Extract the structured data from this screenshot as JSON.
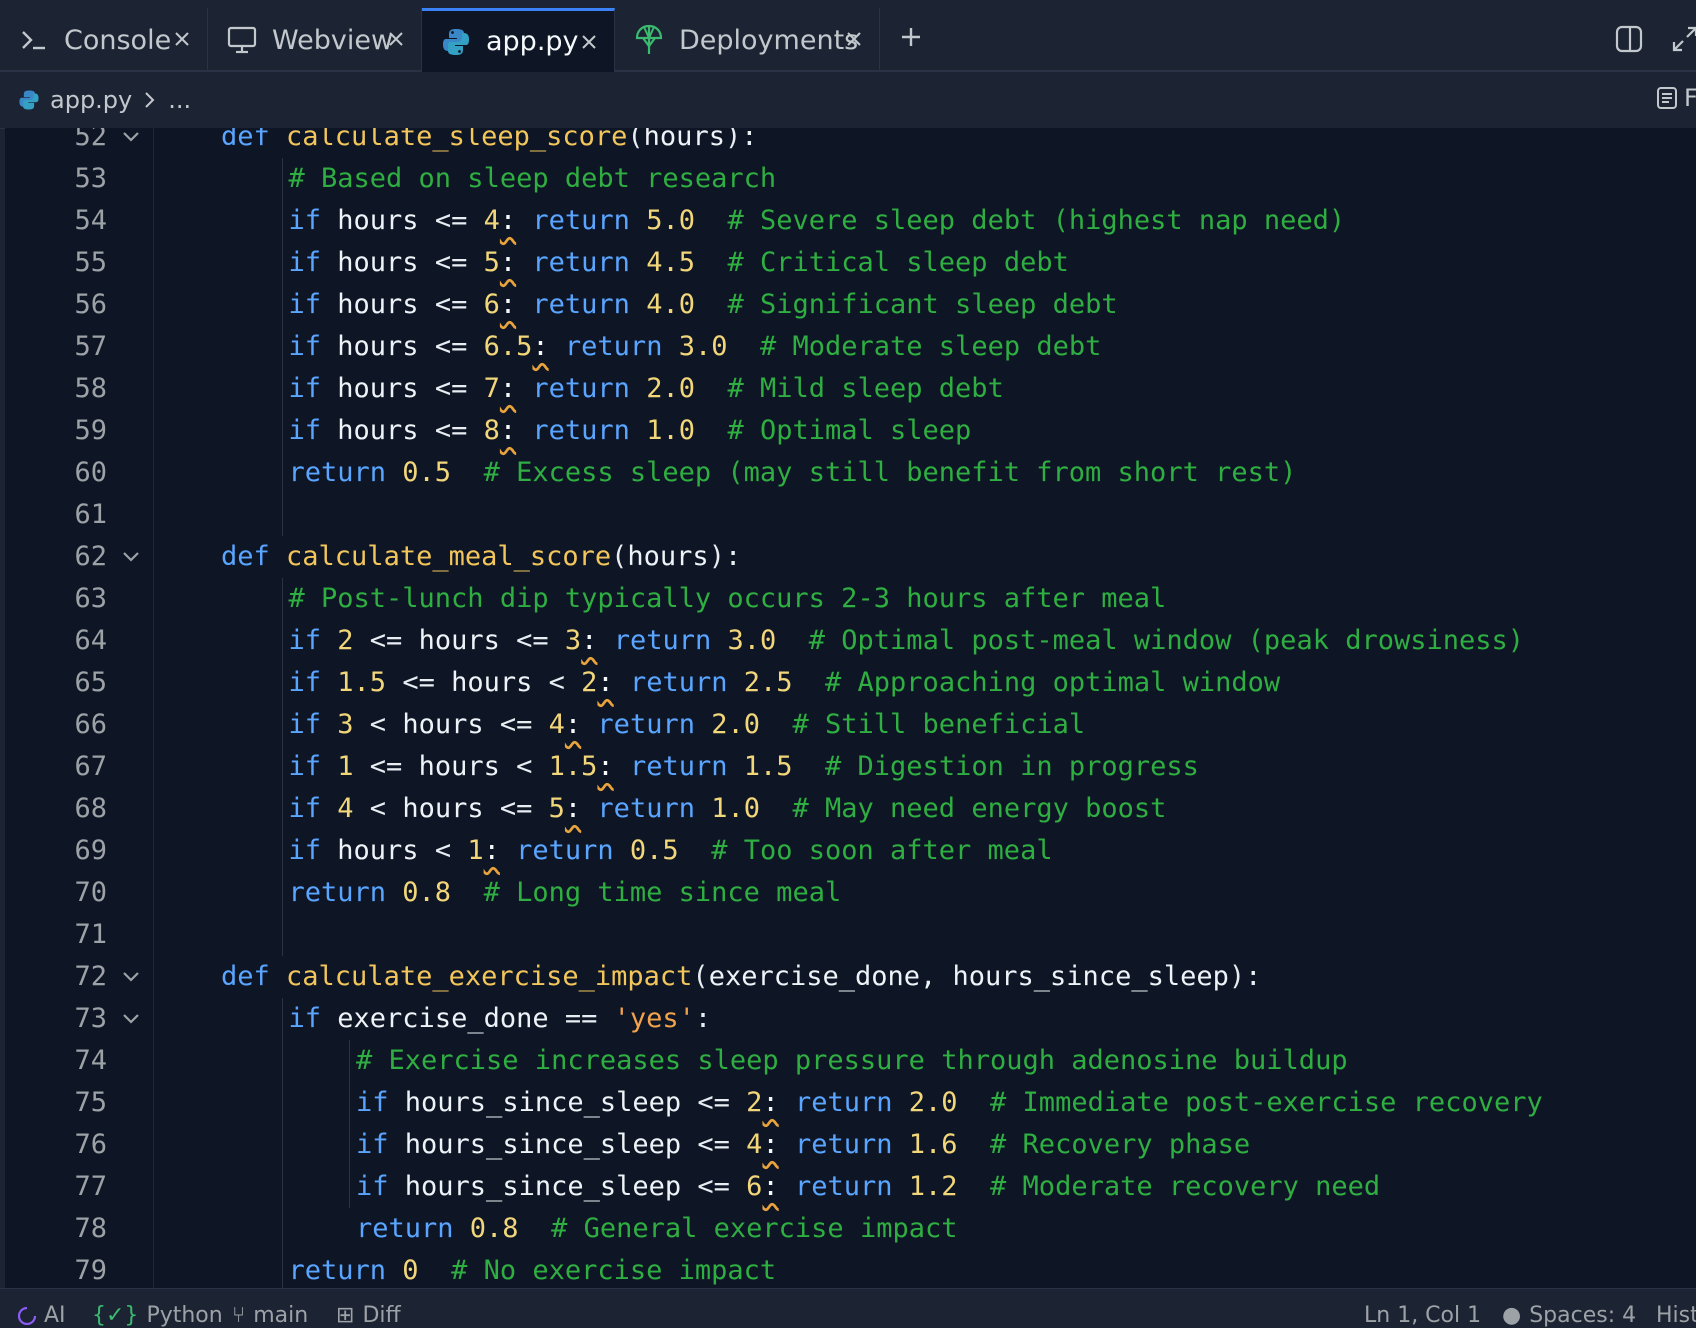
{
  "tabs": [
    {
      "label": "Console",
      "icon": "terminal-icon"
    },
    {
      "label": "Webview",
      "icon": "monitor-icon"
    },
    {
      "label": "app.py",
      "icon": "python-icon",
      "active": true
    },
    {
      "label": "Deployments",
      "icon": "deploy-icon"
    }
  ],
  "breadcrumb": {
    "file": "app.py",
    "rest": "...",
    "right_label": "F"
  },
  "lines": [
    {
      "n": "52",
      "fold": true,
      "indent": 1,
      "t": [
        [
          "kw",
          "def "
        ],
        [
          "fn",
          "calculate_sleep_score"
        ],
        [
          "op",
          "("
        ],
        [
          "id",
          "hours"
        ],
        [
          "op",
          "):"
        ]
      ]
    },
    {
      "n": "53",
      "indent": 2,
      "t": [
        [
          "cm",
          "# Based on sleep debt research"
        ]
      ]
    },
    {
      "n": "54",
      "indent": 2,
      "t": [
        [
          "kw",
          "if "
        ],
        [
          "id",
          "hours "
        ],
        [
          "op",
          "<= "
        ],
        [
          "nm",
          "4"
        ],
        [
          "sq",
          ":"
        ],
        [
          "kw",
          " return "
        ],
        [
          "nm",
          "5.0"
        ],
        [
          "cm",
          "  # Severe sleep debt (highest nap need)"
        ]
      ]
    },
    {
      "n": "55",
      "indent": 2,
      "t": [
        [
          "kw",
          "if "
        ],
        [
          "id",
          "hours "
        ],
        [
          "op",
          "<= "
        ],
        [
          "nm",
          "5"
        ],
        [
          "sq",
          ":"
        ],
        [
          "kw",
          " return "
        ],
        [
          "nm",
          "4.5"
        ],
        [
          "cm",
          "  # Critical sleep debt"
        ]
      ]
    },
    {
      "n": "56",
      "indent": 2,
      "t": [
        [
          "kw",
          "if "
        ],
        [
          "id",
          "hours "
        ],
        [
          "op",
          "<= "
        ],
        [
          "nm",
          "6"
        ],
        [
          "sq",
          ":"
        ],
        [
          "kw",
          " return "
        ],
        [
          "nm",
          "4.0"
        ],
        [
          "cm",
          "  # Significant sleep debt"
        ]
      ]
    },
    {
      "n": "57",
      "indent": 2,
      "t": [
        [
          "kw",
          "if "
        ],
        [
          "id",
          "hours "
        ],
        [
          "op",
          "<= "
        ],
        [
          "nm",
          "6.5"
        ],
        [
          "sq",
          ":"
        ],
        [
          "kw",
          " return "
        ],
        [
          "nm",
          "3.0"
        ],
        [
          "cm",
          "  # Moderate sleep debt"
        ]
      ]
    },
    {
      "n": "58",
      "indent": 2,
      "t": [
        [
          "kw",
          "if "
        ],
        [
          "id",
          "hours "
        ],
        [
          "op",
          "<= "
        ],
        [
          "nm",
          "7"
        ],
        [
          "sq",
          ":"
        ],
        [
          "kw",
          " return "
        ],
        [
          "nm",
          "2.0"
        ],
        [
          "cm",
          "  # Mild sleep debt"
        ]
      ]
    },
    {
      "n": "59",
      "indent": 2,
      "t": [
        [
          "kw",
          "if "
        ],
        [
          "id",
          "hours "
        ],
        [
          "op",
          "<= "
        ],
        [
          "nm",
          "8"
        ],
        [
          "sq",
          ":"
        ],
        [
          "kw",
          " return "
        ],
        [
          "nm",
          "1.0"
        ],
        [
          "cm",
          "  # Optimal sleep"
        ]
      ]
    },
    {
      "n": "60",
      "indent": 2,
      "t": [
        [
          "kw",
          "return "
        ],
        [
          "nm",
          "0.5"
        ],
        [
          "cm",
          "  # Excess sleep (may still benefit from short rest)"
        ]
      ]
    },
    {
      "n": "61",
      "indent": 2,
      "t": []
    },
    {
      "n": "62",
      "fold": true,
      "indent": 1,
      "t": [
        [
          "kw",
          "def "
        ],
        [
          "fn",
          "calculate_meal_score"
        ],
        [
          "op",
          "("
        ],
        [
          "id",
          "hours"
        ],
        [
          "op",
          "):"
        ]
      ]
    },
    {
      "n": "63",
      "indent": 2,
      "t": [
        [
          "cm",
          "# Post-lunch dip typically occurs 2-3 hours after meal"
        ]
      ]
    },
    {
      "n": "64",
      "indent": 2,
      "t": [
        [
          "kw",
          "if "
        ],
        [
          "nm",
          "2 "
        ],
        [
          "op",
          "<= "
        ],
        [
          "id",
          "hours "
        ],
        [
          "op",
          "<= "
        ],
        [
          "nm",
          "3"
        ],
        [
          "sq",
          ":"
        ],
        [
          "kw",
          " return "
        ],
        [
          "nm",
          "3.0"
        ],
        [
          "cm",
          "  # Optimal post-meal window (peak drowsiness)"
        ]
      ]
    },
    {
      "n": "65",
      "indent": 2,
      "t": [
        [
          "kw",
          "if "
        ],
        [
          "nm",
          "1.5 "
        ],
        [
          "op",
          "<= "
        ],
        [
          "id",
          "hours "
        ],
        [
          "op",
          "< "
        ],
        [
          "nm",
          "2"
        ],
        [
          "sq",
          ":"
        ],
        [
          "kw",
          " return "
        ],
        [
          "nm",
          "2.5"
        ],
        [
          "cm",
          "  # Approaching optimal window"
        ]
      ]
    },
    {
      "n": "66",
      "indent": 2,
      "t": [
        [
          "kw",
          "if "
        ],
        [
          "nm",
          "3 "
        ],
        [
          "op",
          "< "
        ],
        [
          "id",
          "hours "
        ],
        [
          "op",
          "<= "
        ],
        [
          "nm",
          "4"
        ],
        [
          "sq",
          ":"
        ],
        [
          "kw",
          " return "
        ],
        [
          "nm",
          "2.0"
        ],
        [
          "cm",
          "  # Still beneficial"
        ]
      ]
    },
    {
      "n": "67",
      "indent": 2,
      "t": [
        [
          "kw",
          "if "
        ],
        [
          "nm",
          "1 "
        ],
        [
          "op",
          "<= "
        ],
        [
          "id",
          "hours "
        ],
        [
          "op",
          "< "
        ],
        [
          "nm",
          "1.5"
        ],
        [
          "sq",
          ":"
        ],
        [
          "kw",
          " return "
        ],
        [
          "nm",
          "1.5"
        ],
        [
          "cm",
          "  # Digestion in progress"
        ]
      ]
    },
    {
      "n": "68",
      "indent": 2,
      "t": [
        [
          "kw",
          "if "
        ],
        [
          "nm",
          "4 "
        ],
        [
          "op",
          "< "
        ],
        [
          "id",
          "hours "
        ],
        [
          "op",
          "<= "
        ],
        [
          "nm",
          "5"
        ],
        [
          "sq",
          ":"
        ],
        [
          "kw",
          " return "
        ],
        [
          "nm",
          "1.0"
        ],
        [
          "cm",
          "  # May need energy boost"
        ]
      ]
    },
    {
      "n": "69",
      "indent": 2,
      "t": [
        [
          "kw",
          "if "
        ],
        [
          "id",
          "hours "
        ],
        [
          "op",
          "< "
        ],
        [
          "nm",
          "1"
        ],
        [
          "sq",
          ":"
        ],
        [
          "kw",
          " return "
        ],
        [
          "nm",
          "0.5"
        ],
        [
          "cm",
          "  # Too soon after meal"
        ]
      ]
    },
    {
      "n": "70",
      "indent": 2,
      "t": [
        [
          "kw",
          "return "
        ],
        [
          "nm",
          "0.8"
        ],
        [
          "cm",
          "  # Long time since meal"
        ]
      ]
    },
    {
      "n": "71",
      "indent": 2,
      "t": []
    },
    {
      "n": "72",
      "fold": true,
      "indent": 1,
      "t": [
        [
          "kw",
          "def "
        ],
        [
          "fn",
          "calculate_exercise_impact"
        ],
        [
          "op",
          "("
        ],
        [
          "id",
          "exercise_done, hours_since_sleep"
        ],
        [
          "op",
          "):"
        ]
      ]
    },
    {
      "n": "73",
      "fold": true,
      "indent": 2,
      "t": [
        [
          "kw",
          "if "
        ],
        [
          "id",
          "exercise_done "
        ],
        [
          "op",
          "== "
        ],
        [
          "st",
          "'yes'"
        ],
        [
          "op",
          ":"
        ]
      ]
    },
    {
      "n": "74",
      "indent": 3,
      "t": [
        [
          "cm",
          "# Exercise increases sleep pressure through adenosine buildup"
        ]
      ]
    },
    {
      "n": "75",
      "indent": 3,
      "t": [
        [
          "kw",
          "if "
        ],
        [
          "id",
          "hours_since_sleep "
        ],
        [
          "op",
          "<= "
        ],
        [
          "nm",
          "2"
        ],
        [
          "sq",
          ":"
        ],
        [
          "kw",
          " return "
        ],
        [
          "nm",
          "2.0"
        ],
        [
          "cm",
          "  # Immediate post-exercise recovery"
        ]
      ]
    },
    {
      "n": "76",
      "indent": 3,
      "t": [
        [
          "kw",
          "if "
        ],
        [
          "id",
          "hours_since_sleep "
        ],
        [
          "op",
          "<= "
        ],
        [
          "nm",
          "4"
        ],
        [
          "sq",
          ":"
        ],
        [
          "kw",
          " return "
        ],
        [
          "nm",
          "1.6"
        ],
        [
          "cm",
          "  # Recovery phase"
        ]
      ]
    },
    {
      "n": "77",
      "indent": 3,
      "t": [
        [
          "kw",
          "if "
        ],
        [
          "id",
          "hours_since_sleep "
        ],
        [
          "op",
          "<= "
        ],
        [
          "nm",
          "6"
        ],
        [
          "sq",
          ":"
        ],
        [
          "kw",
          " return "
        ],
        [
          "nm",
          "1.2"
        ],
        [
          "cm",
          "  # Moderate recovery need"
        ]
      ]
    },
    {
      "n": "78",
      "indent": 3,
      "t": [
        [
          "kw",
          "return "
        ],
        [
          "nm",
          "0.8"
        ],
        [
          "cm",
          "  # General exercise impact"
        ]
      ]
    },
    {
      "n": "79",
      "indent": 2,
      "t": [
        [
          "kw",
          "return "
        ],
        [
          "nm",
          "0"
        ],
        [
          "cm",
          "  # No exercise impact"
        ]
      ]
    }
  ],
  "status": {
    "ai": "AI",
    "language": "Python",
    "branch": "main",
    "diff": "Diff",
    "position": "Ln 1, Col 1",
    "spaces": "Spaces: 4",
    "history": "Hist"
  }
}
